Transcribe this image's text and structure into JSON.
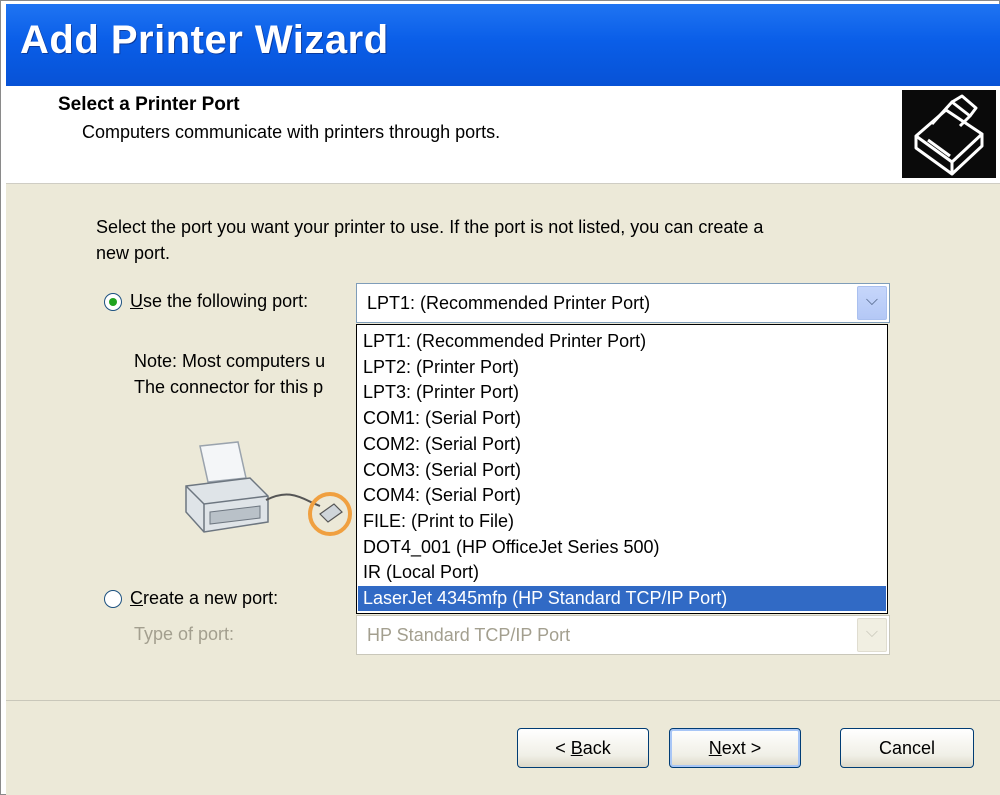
{
  "window": {
    "title": "Add Printer Wizard"
  },
  "header": {
    "title": "Select a Printer Port",
    "subtitle": "Computers communicate with printers through ports.",
    "icon": "printer-wizard-icon"
  },
  "instructions": {
    "line1": "Select the port you want your printer to use.  If the port is not listed, you can create a",
    "line2": "new port."
  },
  "use_port": {
    "label_underlined": "U",
    "label_rest": "se the following port:",
    "selected": true,
    "combo_value": "LPT1: (Recommended Printer Port)"
  },
  "note": {
    "line1": "Note: Most computers u",
    "line2": "The connector for this p"
  },
  "port_options": [
    "LPT1: (Recommended Printer Port)",
    "LPT2: (Printer Port)",
    "LPT3: (Printer Port)",
    "COM1: (Serial Port)",
    "COM2: (Serial Port)",
    "COM3: (Serial Port)",
    "COM4: (Serial Port)",
    "FILE: (Print to File)",
    "DOT4_001 (HP OfficeJet Series 500)",
    "IR (Local Port)",
    "LaserJet 4345mfp (HP Standard TCP/IP Port)"
  ],
  "highlighted_option": "LaserJet 4345mfp (HP Standard TCP/IP Port)",
  "create_port": {
    "label_underlined": "C",
    "label_rest": "reate a new port:",
    "selected": false,
    "type_label": "Type of port:",
    "type_value": "HP Standard TCP/IP Port"
  },
  "buttons": {
    "back_prefix": "< ",
    "back_underlined": "B",
    "back_rest": "ack",
    "next_underlined": "N",
    "next_rest": "ext >",
    "cancel": "Cancel"
  },
  "colors": {
    "title_bar": "#0a5ee8",
    "selection": "#316ac5",
    "dialog_bg": "#ece9d8",
    "radio_dot": "#1fa31f",
    "port_highlight_ring": "#f0a040"
  }
}
